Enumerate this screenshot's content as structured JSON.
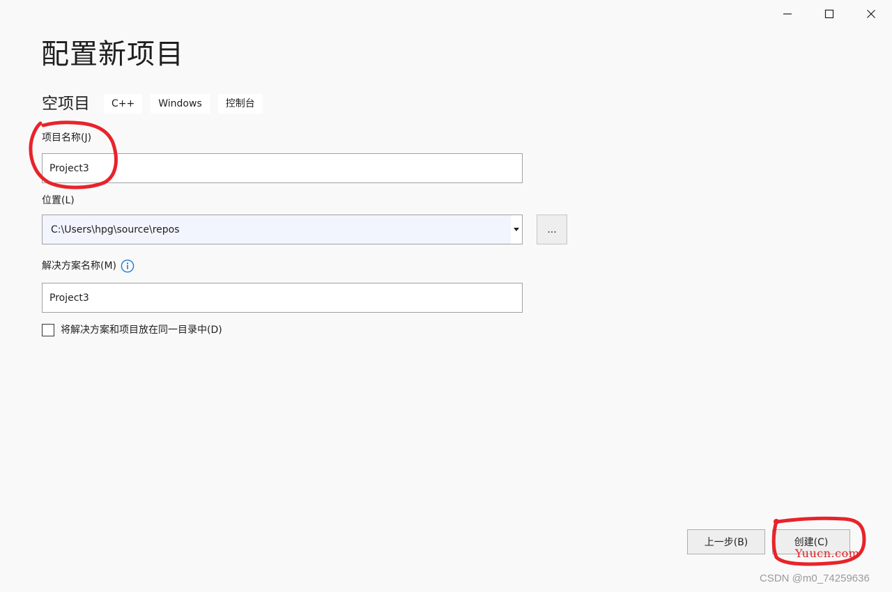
{
  "window": {
    "controls": [
      "minimize-icon",
      "maximize-icon",
      "close-icon"
    ]
  },
  "header": {
    "title": "配置新项目"
  },
  "template": {
    "name": "空项目",
    "tags": [
      "C++",
      "Windows",
      "控制台"
    ]
  },
  "form": {
    "project_name": {
      "label": "项目名称(J)",
      "value": "Project3"
    },
    "location": {
      "label": "位置(L)",
      "value": "C:\\Users\\hpg\\source\\repos",
      "browse_label": "..."
    },
    "solution_name": {
      "label": "解决方案名称(M)",
      "value": "Project3",
      "info_icon": "info-icon"
    },
    "same_directory": {
      "label": "将解决方案和项目放在同一目录中(D)",
      "checked": false
    }
  },
  "footer": {
    "back_label": "上一步(B)",
    "create_label": "创建(C)"
  },
  "watermarks": {
    "site": "Yuucn.com",
    "author": "CSDN @m0_74259636"
  },
  "colors": {
    "annotation": "#e8232a",
    "info_icon": "#1f7ad1",
    "background": "#f9f9fa"
  }
}
